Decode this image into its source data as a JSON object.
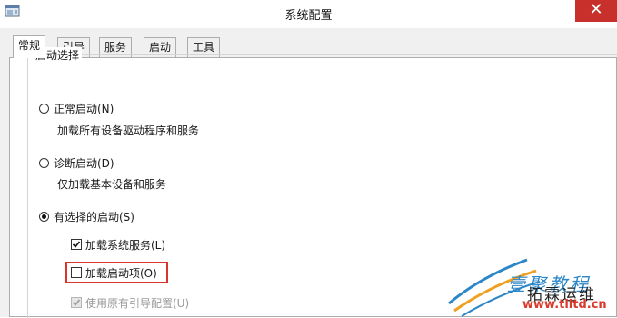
{
  "window": {
    "title": "系统配置",
    "close_glyph": "✕",
    "app_icon": "system-config-icon"
  },
  "tabs": [
    {
      "label": "常规",
      "active": true
    },
    {
      "label": "引导",
      "active": false
    },
    {
      "label": "服务",
      "active": false
    },
    {
      "label": "启动",
      "active": false
    },
    {
      "label": "工具",
      "active": false
    }
  ],
  "startup_selection": {
    "group_title": "启动选择",
    "options": [
      {
        "label": "正常启动(N)",
        "description": "加载所有设备驱动程序和服务",
        "selected": false
      },
      {
        "label": "诊断启动(D)",
        "description": "仅加载基本设备和服务",
        "selected": false
      },
      {
        "label": "有选择的启动(S)",
        "selected": true
      }
    ],
    "selective_items": [
      {
        "label": "加载系统服务(L)",
        "checked": true,
        "enabled": true
      },
      {
        "label": "加载启动项(O)",
        "checked": false,
        "enabled": true,
        "highlighted": true
      },
      {
        "label": "使用原有引导配置(U)",
        "checked": true,
        "enabled": false
      }
    ]
  },
  "watermark": {
    "line1": "壹聚教程",
    "line2": "拓霖运维",
    "url": "www.tlltd.cn"
  },
  "colors": {
    "close_button": "#c7302b",
    "highlight_box": "#d9352b",
    "watermark_blue": "#2d86c8",
    "watermark_red": "#d93a2b"
  }
}
